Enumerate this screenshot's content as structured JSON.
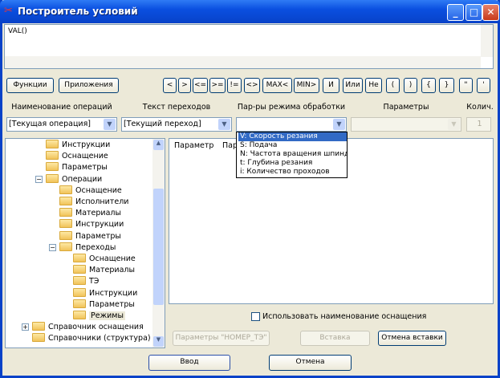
{
  "window": {
    "title": "Построитель условий"
  },
  "editor": {
    "value": "VAL()"
  },
  "toolbar": {
    "functions": "Функции",
    "apps": "Приложения",
    "ops": [
      "<",
      ">",
      "<=",
      ">=",
      "!=",
      "<>",
      "MAX<",
      "MIN>",
      "И",
      "Или",
      "Не",
      "(",
      ")",
      "{",
      "}",
      "\"",
      "'"
    ]
  },
  "labels": {
    "op_name": "Наименование операций",
    "transition_text": "Текст переходов",
    "mode_params": "Пар-ры режима обработки",
    "params": "Параметры",
    "qty": "Колич."
  },
  "combos": {
    "operation": "[Текущая операция]",
    "transition": "[Текущий переход]",
    "mode": "",
    "params": "",
    "qty": "1"
  },
  "dropdown": {
    "items": [
      "V: Скорость резания",
      "S: Подача",
      "N: Частота вращения шпинделя",
      "t: Глубина резания",
      "i: Количество проходов"
    ],
    "selected": 0
  },
  "tree": {
    "items": [
      {
        "label": "Инструкции",
        "level": 2
      },
      {
        "label": "Оснащение",
        "level": 2
      },
      {
        "label": "Параметры",
        "level": 2
      },
      {
        "label": "Операции",
        "level": 2,
        "expanded": true
      },
      {
        "label": "Оснащение",
        "level": 3
      },
      {
        "label": "Исполнители",
        "level": 3
      },
      {
        "label": "Материалы",
        "level": 3
      },
      {
        "label": "Инструкции",
        "level": 3
      },
      {
        "label": "Параметры",
        "level": 3
      },
      {
        "label": "Переходы",
        "level": 3,
        "expanded": true
      },
      {
        "label": "Оснащение",
        "level": 4
      },
      {
        "label": "Материалы",
        "level": 4
      },
      {
        "label": "ТЭ",
        "level": 4
      },
      {
        "label": "Инструкции",
        "level": 4
      },
      {
        "label": "Параметры",
        "level": 4
      },
      {
        "label": "Режимы",
        "level": 4,
        "selected": true
      },
      {
        "label": "Справочник оснащения",
        "level": 1,
        "collapsed": true
      },
      {
        "label": "Справочники (структура)",
        "level": 1
      }
    ]
  },
  "list": {
    "columns": [
      "Параметр",
      "Пар"
    ]
  },
  "options": {
    "use_equipment_name": "Использовать наименование оснащения",
    "use_equipment_checked": false
  },
  "actions": {
    "params_nomer": "Параметры \"НОМЕР_ТЭ\"",
    "insert": "Вставка",
    "cancel_insert": "Отмена вставки",
    "ok": "Ввод",
    "cancel": "Отмена"
  }
}
